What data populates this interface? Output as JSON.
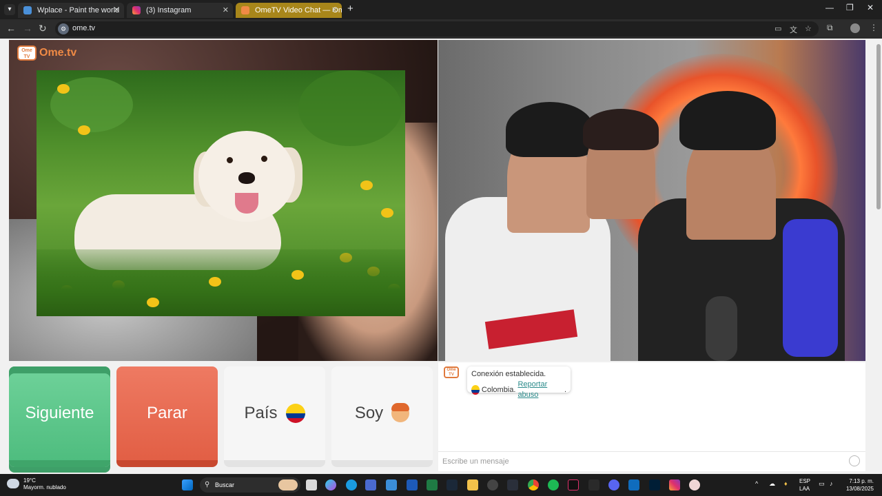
{
  "browser": {
    "tabs": [
      {
        "title": "Wplace - Paint the world",
        "active": false
      },
      {
        "title": "(3) Instagram",
        "active": false
      },
      {
        "title": "OmeTV Video Chat — Ome",
        "active": true
      }
    ],
    "url": "ome.tv"
  },
  "page": {
    "logo_text": "Ome.tv",
    "logo_badge": "Ome TV",
    "buttons": {
      "next": "Siguiente",
      "stop": "Parar",
      "country": "País",
      "me": "Soy"
    },
    "country_flag_colors": [
      "#fcd116",
      "#003893",
      "#ce1126"
    ],
    "chat": {
      "status": "Conexión establecida.",
      "country": "Colombia.",
      "report_link": "Reportar abuso",
      "report_suffix": ".",
      "input_placeholder": "Escribe un mensaje"
    }
  },
  "taskbar": {
    "weather_temp": "19°C",
    "weather_desc": "Mayorm. nublado",
    "search_placeholder": "Buscar",
    "language": "ESP",
    "language_sub": "LAA",
    "time": "7:13 p. m.",
    "date": "13/08/2025"
  }
}
